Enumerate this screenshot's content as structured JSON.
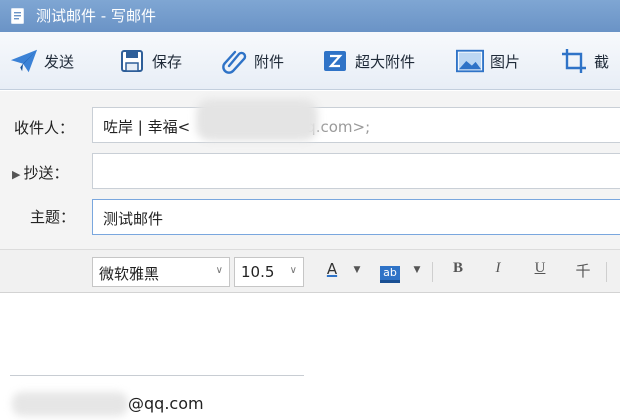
{
  "window": {
    "title": "测试邮件 - 写邮件"
  },
  "toolbar": {
    "send_label": "发送",
    "save_label": "保存",
    "attach_label": "附件",
    "large_attach_label": "超大附件",
    "image_label": "图片",
    "screenshot_label": "截"
  },
  "header": {
    "to_label": "收件人：",
    "to_value_name": "咗岸 | 幸福<",
    "to_value_domain": "q.com>;",
    "cc_label": "抄送：",
    "cc_value": "",
    "subject_label": "主题：",
    "subject_value": "测试邮件"
  },
  "format": {
    "font_family": "微软雅黑",
    "font_size": "10.5",
    "font_color_label": "A",
    "bg_color_label": "ab",
    "bold_label": "B",
    "italic_label": "I",
    "underline_label": "U",
    "strike_label": "千"
  },
  "body": {
    "signature_email_suffix": "@qq.com"
  },
  "colors": {
    "titlebar": "#6a93c6",
    "accent_blue": "#2f73c7",
    "focus_border": "#7aa7de"
  },
  "icons": [
    "document-icon",
    "send-plane-icon",
    "save-disk-icon",
    "paperclip-icon",
    "large-attach-icon",
    "image-icon",
    "screenshot-crop-icon",
    "chevron-down-icon"
  ]
}
